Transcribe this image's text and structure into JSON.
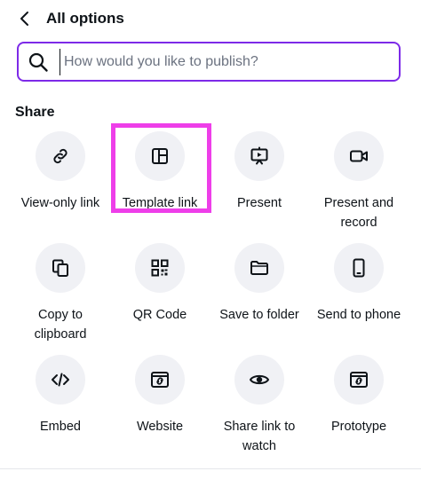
{
  "header": {
    "title": "All options"
  },
  "search": {
    "placeholder": "How would you like to publish?"
  },
  "section": {
    "label": "Share"
  },
  "colors": {
    "accent": "#7d2ae8",
    "highlight": "#ee3ee9",
    "circle_bg": "#f0f1f5"
  },
  "tiles": [
    {
      "label": "View-only link",
      "icon": "link-icon"
    },
    {
      "label": "Template link",
      "icon": "template-icon"
    },
    {
      "label": "Present",
      "icon": "present-icon"
    },
    {
      "label": "Present and record",
      "icon": "video-camera-icon"
    },
    {
      "label": "Copy to clipboard",
      "icon": "copy-icon"
    },
    {
      "label": "QR Code",
      "icon": "qr-code-icon"
    },
    {
      "label": "Save to folder",
      "icon": "folder-icon"
    },
    {
      "label": "Send to phone",
      "icon": "phone-icon"
    },
    {
      "label": "Embed",
      "icon": "code-icon"
    },
    {
      "label": "Website",
      "icon": "website-icon"
    },
    {
      "label": "Share link to watch",
      "icon": "eye-icon"
    },
    {
      "label": "Prototype",
      "icon": "prototype-icon"
    }
  ]
}
